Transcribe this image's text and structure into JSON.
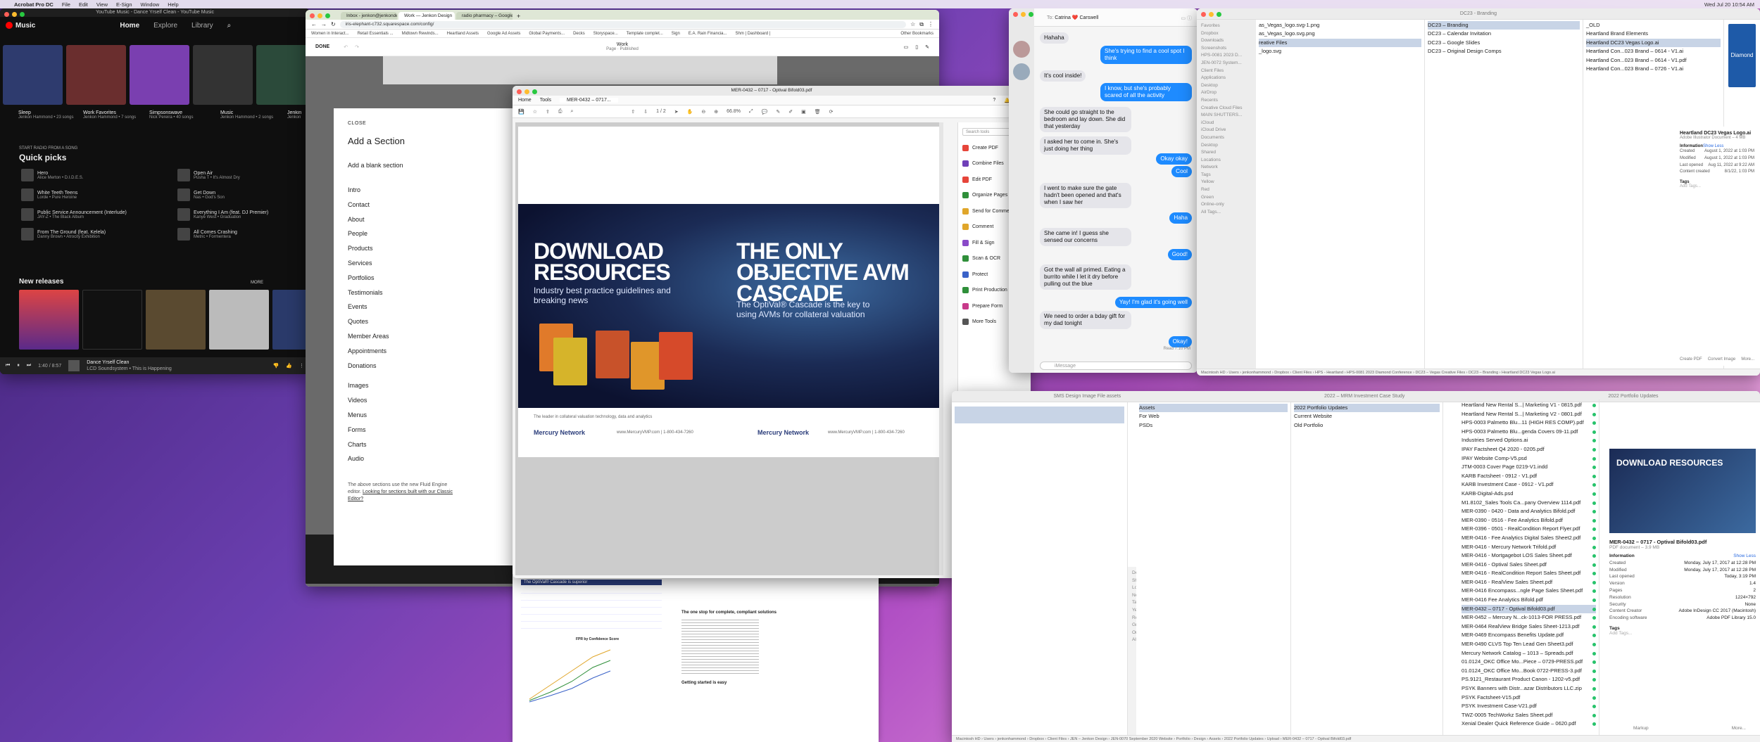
{
  "menubar": {
    "app": "Acrobat Pro DC",
    "items": [
      "File",
      "Edit",
      "View",
      "E-Sign",
      "Window",
      "Help"
    ],
    "right": [
      "Wed Jul 20 10:54 AM"
    ]
  },
  "ytm": {
    "window_title": "YouTube Music - Dance Yrself Clean - YouTube Music",
    "logo": "Music",
    "nav": [
      "Home",
      "Explore",
      "Library"
    ],
    "mixes": [
      {
        "title": "Sleep",
        "sub": "Jenkon Hammond • 23 songs",
        "color": "#2e3b6e"
      },
      {
        "title": "Work Favorites",
        "sub": "Jenkon Hammond • 7 songs",
        "color": "#6a2e2e"
      },
      {
        "title": "Simpsonswave",
        "sub": "Nick Pereira • 40 songs",
        "color": "#7a3fb0"
      },
      {
        "title": "Music",
        "sub": "Jenkon Hammond • 2 songs",
        "color": "#333"
      },
      {
        "title": "Jenkin",
        "sub": "Jenkon",
        "color": "#2b4a3a"
      }
    ],
    "start_radio": "START RADIO FROM A SONG",
    "quick_picks_title": "Quick picks",
    "quick_picks": [
      {
        "title": "Hero",
        "sub": "Alice Merton • D.I.D.E.S."
      },
      {
        "title": "Open Air",
        "sub": "Pusha T • It's Almost Dry"
      },
      {
        "title": "White Teeth Teens",
        "sub": "Lorde • Pure Heroine"
      },
      {
        "title": "Get Down",
        "sub": "Nas • God's Son"
      },
      {
        "title": "Public Service Announcement (Interlude)",
        "sub": "JAY-Z • The Black Album"
      },
      {
        "title": "Everything I Am (feat. DJ Premier)",
        "sub": "Kanye West • Graduation"
      },
      {
        "title": "From The Ground (feat. Kelela)",
        "sub": "Danny Brown • Atrocity Exhibition"
      },
      {
        "title": "All Comes Crashing",
        "sub": "Metric • Formentera"
      }
    ],
    "new_releases": "New releases",
    "more": "MORE",
    "player": {
      "time": "1:40 / 8:57",
      "title": "Dance Yrself Clean",
      "sub": "LCD Soundsystem • This is Happening"
    }
  },
  "chrome": {
    "tabs": [
      "Inbox - jenkon@jenkondesign.com",
      "Work — Jenkon Design",
      "radio pharmacy – Google Search"
    ],
    "url": "iris-elephant-c732.squarespace.com/config/",
    "bookmarks": [
      "Women in Interact...",
      "Retail Essentials ...",
      "Midtown Rewinds...",
      "Heartland Assets",
      "Google Ad Assets",
      "Global Payments...",
      "Decks",
      "Storyspace...",
      "Template complet...",
      "Sign",
      "E.A. Rain Financia...",
      "Shm | Dashboard |"
    ],
    "other_bookmarks": "Other Bookmarks",
    "done": "DONE",
    "page_title": "Work",
    "page_status": "Page · Published"
  },
  "add_section": {
    "close": "CLOSE",
    "title": "Add a Section",
    "blank": "Add a blank section",
    "group1": [
      "Intro",
      "Contact",
      "About",
      "People",
      "Products",
      "Services",
      "Portfolios",
      "Testimonials",
      "Events",
      "Quotes",
      "Member Areas",
      "Appointments",
      "Donations"
    ],
    "group2": [
      "Images",
      "Videos",
      "Menus",
      "Forms",
      "Charts",
      "Audio"
    ],
    "note_a": "The above sections use the new Fluid Engine editor.",
    "note_link": "Looking for sections built with our Classic Editor?"
  },
  "acrobat": {
    "title": "MER-0432 – 0717 - Optival Bifold03.pdf",
    "menu": [
      "Home",
      "Tools"
    ],
    "doc_tab": "MER-0432 – 0717...",
    "page_indicator": "1 / 2",
    "zoom": "66.8%",
    "hero": {
      "h1a": "DOWNLOAD RESOURCES",
      "p1": "Industry best practice guidelines and breaking news",
      "h1b": "THE ONLY OBJECTIVE AVM CASCADE",
      "p2": "The OptiVal® Cascade is the key to using AVMs for collateral valuation"
    },
    "foot": [
      "The leader in collateral valuation technology, data and analytics",
      "Mercury Network",
      "www.MercuryVMP.com | 1-800-434-7260",
      "Mercury Network",
      "www.MercuryVMP.com | 1-800-434-7260"
    ],
    "search": "Search tools",
    "tools": [
      {
        "label": "Create PDF",
        "color": "#e6453a"
      },
      {
        "label": "Combine Files",
        "color": "#6f3fb8"
      },
      {
        "label": "Edit PDF",
        "color": "#e6453a"
      },
      {
        "label": "Organize Pages",
        "color": "#2f8f3a"
      },
      {
        "label": "Send for Comments",
        "color": "#e0a62a"
      },
      {
        "label": "Comment",
        "color": "#e0a62a"
      },
      {
        "label": "Fill & Sign",
        "color": "#8a4ac8"
      },
      {
        "label": "Scan & OCR",
        "color": "#2f8f3a"
      },
      {
        "label": "Protect",
        "color": "#3a62c8"
      },
      {
        "label": "Print Production",
        "color": "#2f8f3a"
      },
      {
        "label": "Prepare Form",
        "color": "#c83a8a"
      },
      {
        "label": "More Tools",
        "color": "#555"
      }
    ]
  },
  "lowdoc": {
    "h": "The OptiVal® Cascade is superior",
    "s1": "The one stop for complete, compliant solutions",
    "s2": "FPR by Confidence Score",
    "s3": "Getting started is easy"
  },
  "messages": {
    "to_label": "To:",
    "contact": "Catrina ❤️ Carswell",
    "bubbles": [
      {
        "dir": "in",
        "text": "Hahaha"
      },
      {
        "dir": "out",
        "text": "She's trying to find a cool spot I think"
      },
      {
        "dir": "in",
        "text": "It's cool inside!"
      },
      {
        "dir": "out",
        "text": "I know, but she's probably scared of all the activity"
      },
      {
        "dir": "in",
        "text": "She could go straight to the bedroom and lay down. She did that yesterday"
      },
      {
        "dir": "in",
        "text": "I asked her to come in. She's just doing her thing"
      },
      {
        "dir": "out",
        "text": "Okay okay"
      },
      {
        "dir": "out",
        "text": "Cool"
      },
      {
        "dir": "in",
        "text": "I went to make sure the gate hadn't been opened and that's when I saw her"
      },
      {
        "dir": "out",
        "text": "Haha"
      },
      {
        "dir": "in",
        "text": "She came in! I guess she sensed our concerns"
      },
      {
        "dir": "out",
        "text": "Good!"
      },
      {
        "dir": "in",
        "text": "Got the wall all primed. Eating a burrito while I let it dry before pulling out the blue"
      },
      {
        "dir": "out",
        "text": "Yay! I'm glad it's going well"
      },
      {
        "dir": "in",
        "text": "We need to order a bday gift for my dad tonight"
      },
      {
        "dir": "out",
        "text": "Okay!"
      }
    ],
    "read": "Read 7:10 PM",
    "placeholder": "iMessage"
  },
  "finder_top": {
    "title": "DC23 - Branding",
    "sidebar": [
      "Favorites",
      "Dropbox",
      "Downloads",
      "Screenshots",
      "HPS-0081 2023 D...",
      "JEN-0072 System...",
      "",
      "",
      "Client Files",
      "",
      "Applications",
      "Desktop",
      "AirDrop",
      "Recents",
      "Creative Cloud Files",
      "MAIN SHUTTERS...",
      "iCloud",
      "iCloud Drive",
      "Documents",
      "Desktop",
      "Shared",
      "Locations",
      "Network",
      "Tags",
      "Yellow",
      "Red",
      "Green",
      "Online-only",
      "All Tags..."
    ],
    "col1": [
      "as_Vegas_logo.svg-1.png",
      "as_Vegas_logo.svg.png",
      "",
      "",
      "reative Files",
      "_logo.svg"
    ],
    "col2": [
      "DC23 – Branding",
      "DC23 – Calendar Invitation",
      "DC23 – Google Slides",
      "DC23 – Original Design Comps"
    ],
    "col3": [
      "_OLD",
      "Heartland Brand Elements",
      "Heartland DC23 Vegas Logo.ai",
      "Heartland Con...023 Brand – 0614 - V1.ai",
      "Heartland Con...023 Brand – 0614 - V1.pdf",
      "Heartland Con...023 Brand – 0726 - V1.ai"
    ],
    "preview": {
      "name": "Heartland DC23 Vegas Logo.ai",
      "kind": "Adobe Illustrator Document – 4 MB",
      "info": "Information",
      "show_less": "Show Less",
      "meta": [
        [
          "Created",
          "August 1, 2022 at 1:03 PM"
        ],
        [
          "Modified",
          "August 1, 2022 at 1:03 PM"
        ],
        [
          "Last opened",
          "Aug 11, 2022 at 9:22 AM"
        ],
        [
          "Content created",
          "8/1/22, 1:03 PM"
        ]
      ],
      "tags": "Tags",
      "add_tags": "Add Tags...",
      "actions": [
        "Create PDF",
        "Convert Image",
        "More..."
      ],
      "logo": "Diamond"
    },
    "path": "Macintosh HD › Users › jenkonhammond › Dropbox › Client Files › HPS - Heartland › HPS-0081 2023 Diamond Conference › DC23 – Vegas Creative Files › DC23 – Branding › Heartland DC23 Vegas Logo.ai"
  },
  "finder_bottom": {
    "titles": [
      "SMS Design Image File assets",
      "2022 – MRM Investment Case Study",
      "2022 Portfolio Updates"
    ],
    "col2": [
      "Assets",
      "For Web",
      "PSDs"
    ],
    "col3": [
      "2022 Portfolio Updates",
      "Current Website",
      "Old Portfolio"
    ],
    "sidebar": [
      "Desktop",
      "Shared",
      "Locations",
      "Network",
      "Tags",
      "Yellow",
      "Red",
      "Green",
      "Online-only",
      "All Tags..."
    ],
    "files": [
      "Heartland New Rental S...| Marketing V1 - 0815.pdf",
      "Heartland New Rental S...| Marketing V2 - 0801.pdf",
      "HPS-0003 Palmetto Blu...11 (HIGH RES COMP).pdf",
      "HPS-0003 Palmetto Blu...genda Covers 09-11.pdf",
      "Industries Served Options.ai",
      "IPAY Factsheet Q4 2020 - 0205.pdf",
      "IPAY Website Comp-V5.psd",
      "JTM-0003 Cover Page 0219-V1.indd",
      "KARB Factsheet - 0912 - V1.pdf",
      "KARB Investment Case - 0912 - V1.pdf",
      "KARB-Digital-Ads.psd",
      "M1.8102_Sales Tools Ca...pany Overview 1114.pdf",
      "MER-0390 - 0420 - Data and Analytics Bifold.pdf",
      "MER-0390 - 0516 - Fee Analytics Bifold.pdf",
      "MER-0396 - 0501 - RealCondition Report Flyer.pdf",
      "MER-0416 - Fee Analytics Digital Sales Sheet2.pdf",
      "MER-0416 - Mercury Network Trifold.pdf",
      "MER-0416 - Mortgagebot LOS Sales Sheet.pdf",
      "MER-0416 - Optival Sales Sheet.pdf",
      "MER-0416 - RealCondition Report Sales Sheet.pdf",
      "MER-0416 - RealView Sales Sheet.pdf",
      "MER-0416 Encompass...ngle Page Sales Sheet.pdf",
      "MER-0416 Fee Analytics Bifold.pdf",
      "MER-0432 – 0717 - Optival Bifold03.pdf",
      "MER-0452 – Mercury N...ck-1013-FOR PRESS.pdf",
      "MER-0464 RealView Bridge Sales Sheet-1213.pdf",
      "MER-0469 Encompass Benefits Update.pdf",
      "MER-0490 CLVS Top Ten Lead Gen Sheet3.pdf",
      "Mercury Network Catalog – 1013 – Spreads.pdf",
      "01.0124_OKC Office Mo...Piece – 0729-PRESS.pdf",
      "01.0124_OKC Office Mo...Book 0722-PRESS-3.pdf",
      "PS.9121_Restaurant Product Canon - 1202-v5.pdf",
      "PSYK Banners with Distr...azar Distributors LLC.zip",
      "PSYK Factsheet-V15.pdf",
      "PSYK Investment Case-V21.pdf",
      "TWZ-0005 TechWorkz Sales Sheet.pdf",
      "Xenial Dealer Quick Reference Guide – 0620.pdf"
    ],
    "selected_file": "MER-0432 – 0717 - Optival Bifold03.pdf",
    "preview": {
      "name": "MER-0432 – 0717 - Optival Bifold03.pdf",
      "kind": "PDF document – 3.9 MB",
      "info": "Information",
      "show_less": "Show Less",
      "meta": [
        [
          "Created",
          "Monday, July 17, 2017 at 12:28 PM"
        ],
        [
          "Modified",
          "Monday, July 17, 2017 at 12:28 PM"
        ],
        [
          "Last opened",
          "Today, 3:19 PM"
        ],
        [
          "Version",
          "1.4"
        ],
        [
          "Pages",
          "2"
        ],
        [
          "Resolution",
          "1224×792"
        ],
        [
          "Security",
          "None"
        ],
        [
          "Content Creator",
          "Adobe InDesign CC 2017 (Macintosh)"
        ],
        [
          "Encoding software",
          "Adobe PDF Library 15.0"
        ]
      ],
      "tags": "Tags",
      "add_tags": "Add Tags...",
      "actions": [
        "Markup",
        "More..."
      ]
    },
    "path": "Macintosh HD › Users › jenkonhammond › Dropbox › Client Files › JEN – Jenkon Design › JEN-0070 September 2020 Website › Portfolio › Design › Assets › 2022 Portfolio Updates › Upload › MER-0432 – 0717 - Optival Bifold03.pdf"
  }
}
